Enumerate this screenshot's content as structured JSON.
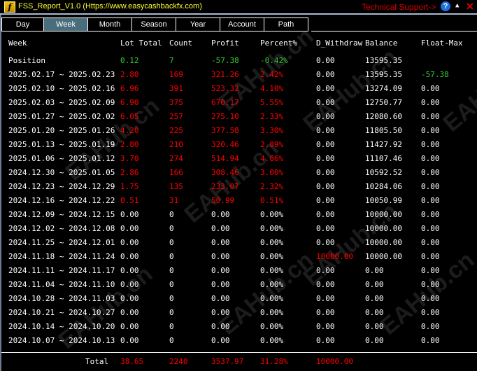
{
  "window": {
    "title": "FSS_Report_V1.0 (Https://www.easycashbackfx.com)",
    "logo_letter": "f",
    "support": "Technical Support->",
    "help": "?",
    "minimize": "▲",
    "close": "✕"
  },
  "tabs": [
    {
      "label": "Day"
    },
    {
      "label": "Week",
      "active": true
    },
    {
      "label": "Month"
    },
    {
      "label": "Season"
    },
    {
      "label": "Year"
    },
    {
      "label": "Account"
    },
    {
      "label": "Path"
    }
  ],
  "colors": {
    "w": "#ffffff",
    "r": "#ff0000",
    "g": "#33cc33"
  },
  "columns": [
    "Week",
    "Lot Total",
    "Count",
    "Profit",
    "Percent%",
    "D_Withdraw",
    "Balance",
    "Float-Max"
  ],
  "rows": [
    [
      [
        "Position",
        "w"
      ],
      [
        "0.12",
        "g"
      ],
      [
        "7",
        "g"
      ],
      [
        "-57.38",
        "g"
      ],
      [
        "-0.42%",
        "g"
      ],
      [
        "0.00",
        "w"
      ],
      [
        "13595.35",
        "w"
      ],
      [
        "",
        "w"
      ]
    ],
    [
      [
        "2025.02.17 ~ 2025.02.23",
        "w"
      ],
      [
        "2.80",
        "r"
      ],
      [
        "169",
        "r"
      ],
      [
        "321.26",
        "r"
      ],
      [
        "2.42%",
        "r"
      ],
      [
        "0.00",
        "w"
      ],
      [
        "13595.35",
        "w"
      ],
      [
        "-57.38",
        "g"
      ]
    ],
    [
      [
        "2025.02.10 ~ 2025.02.16",
        "w"
      ],
      [
        "6.96",
        "r"
      ],
      [
        "391",
        "r"
      ],
      [
        "523.32",
        "r"
      ],
      [
        "4.10%",
        "r"
      ],
      [
        "0.00",
        "w"
      ],
      [
        "13274.09",
        "w"
      ],
      [
        "0.00",
        "w"
      ]
    ],
    [
      [
        "2025.02.03 ~ 2025.02.09",
        "w"
      ],
      [
        "6.90",
        "r"
      ],
      [
        "375",
        "r"
      ],
      [
        "670.17",
        "r"
      ],
      [
        "5.55%",
        "r"
      ],
      [
        "0.00",
        "w"
      ],
      [
        "12750.77",
        "w"
      ],
      [
        "0.00",
        "w"
      ]
    ],
    [
      [
        "2025.01.27 ~ 2025.02.02",
        "w"
      ],
      [
        "6.05",
        "r"
      ],
      [
        "257",
        "r"
      ],
      [
        "275.10",
        "r"
      ],
      [
        "2.33%",
        "r"
      ],
      [
        "0.00",
        "w"
      ],
      [
        "12080.60",
        "w"
      ],
      [
        "0.00",
        "w"
      ]
    ],
    [
      [
        "2025.01.20 ~ 2025.01.26",
        "w"
      ],
      [
        "4.20",
        "r"
      ],
      [
        "225",
        "r"
      ],
      [
        "377.58",
        "r"
      ],
      [
        "3.30%",
        "r"
      ],
      [
        "0.00",
        "w"
      ],
      [
        "11805.50",
        "w"
      ],
      [
        "0.00",
        "w"
      ]
    ],
    [
      [
        "2025.01.13 ~ 2025.01.19",
        "w"
      ],
      [
        "2.80",
        "r"
      ],
      [
        "210",
        "r"
      ],
      [
        "320.46",
        "r"
      ],
      [
        "2.89%",
        "r"
      ],
      [
        "0.00",
        "w"
      ],
      [
        "11427.92",
        "w"
      ],
      [
        "0.00",
        "w"
      ]
    ],
    [
      [
        "2025.01.06 ~ 2025.01.12",
        "w"
      ],
      [
        "3.70",
        "r"
      ],
      [
        "274",
        "r"
      ],
      [
        "514.94",
        "r"
      ],
      [
        "4.86%",
        "r"
      ],
      [
        "0.00",
        "w"
      ],
      [
        "11107.46",
        "w"
      ],
      [
        "0.00",
        "w"
      ]
    ],
    [
      [
        "2024.12.30 ~ 2025.01.05",
        "w"
      ],
      [
        "2.86",
        "r"
      ],
      [
        "166",
        "r"
      ],
      [
        "308.46",
        "r"
      ],
      [
        "3.00%",
        "r"
      ],
      [
        "0.00",
        "w"
      ],
      [
        "10592.52",
        "w"
      ],
      [
        "0.00",
        "w"
      ]
    ],
    [
      [
        "2024.12.23 ~ 2024.12.29",
        "w"
      ],
      [
        "1.75",
        "r"
      ],
      [
        "135",
        "r"
      ],
      [
        "233.07",
        "r"
      ],
      [
        "2.32%",
        "r"
      ],
      [
        "0.00",
        "w"
      ],
      [
        "10284.06",
        "w"
      ],
      [
        "0.00",
        "w"
      ]
    ],
    [
      [
        "2024.12.16 ~ 2024.12.22",
        "w"
      ],
      [
        "0.51",
        "r"
      ],
      [
        "31",
        "r"
      ],
      [
        "50.99",
        "r"
      ],
      [
        "0.51%",
        "r"
      ],
      [
        "0.00",
        "w"
      ],
      [
        "10050.99",
        "w"
      ],
      [
        "0.00",
        "w"
      ]
    ],
    [
      [
        "2024.12.09 ~ 2024.12.15",
        "w"
      ],
      [
        "0.00",
        "w"
      ],
      [
        "0",
        "w"
      ],
      [
        "0.00",
        "w"
      ],
      [
        "0.00%",
        "w"
      ],
      [
        "0.00",
        "w"
      ],
      [
        "10000.00",
        "w"
      ],
      [
        "0.00",
        "w"
      ]
    ],
    [
      [
        "2024.12.02 ~ 2024.12.08",
        "w"
      ],
      [
        "0.00",
        "w"
      ],
      [
        "0",
        "w"
      ],
      [
        "0.00",
        "w"
      ],
      [
        "0.00%",
        "w"
      ],
      [
        "0.00",
        "w"
      ],
      [
        "10000.00",
        "w"
      ],
      [
        "0.00",
        "w"
      ]
    ],
    [
      [
        "2024.11.25 ~ 2024.12.01",
        "w"
      ],
      [
        "0.00",
        "w"
      ],
      [
        "0",
        "w"
      ],
      [
        "0.00",
        "w"
      ],
      [
        "0.00%",
        "w"
      ],
      [
        "0.00",
        "w"
      ],
      [
        "10000.00",
        "w"
      ],
      [
        "0.00",
        "w"
      ]
    ],
    [
      [
        "2024.11.18 ~ 2024.11.24",
        "w"
      ],
      [
        "0.00",
        "w"
      ],
      [
        "0",
        "w"
      ],
      [
        "0.00",
        "w"
      ],
      [
        "0.00%",
        "w"
      ],
      [
        "10000.00",
        "r"
      ],
      [
        "10000.00",
        "w"
      ],
      [
        "0.00",
        "w"
      ]
    ],
    [
      [
        "2024.11.11 ~ 2024.11.17",
        "w"
      ],
      [
        "0.00",
        "w"
      ],
      [
        "0",
        "w"
      ],
      [
        "0.00",
        "w"
      ],
      [
        "0.00%",
        "w"
      ],
      [
        "0.00",
        "w"
      ],
      [
        "0.00",
        "w"
      ],
      [
        "0.00",
        "w"
      ]
    ],
    [
      [
        "2024.11.04 ~ 2024.11.10",
        "w"
      ],
      [
        "0.00",
        "w"
      ],
      [
        "0",
        "w"
      ],
      [
        "0.00",
        "w"
      ],
      [
        "0.00%",
        "w"
      ],
      [
        "0.00",
        "w"
      ],
      [
        "0.00",
        "w"
      ],
      [
        "0.00",
        "w"
      ]
    ],
    [
      [
        "2024.10.28 ~ 2024.11.03",
        "w"
      ],
      [
        "0.00",
        "w"
      ],
      [
        "0",
        "w"
      ],
      [
        "0.00",
        "w"
      ],
      [
        "0.00%",
        "w"
      ],
      [
        "0.00",
        "w"
      ],
      [
        "0.00",
        "w"
      ],
      [
        "0.00",
        "w"
      ]
    ],
    [
      [
        "2024.10.21 ~ 2024.10.27",
        "w"
      ],
      [
        "0.00",
        "w"
      ],
      [
        "0",
        "w"
      ],
      [
        "0.00",
        "w"
      ],
      [
        "0.00%",
        "w"
      ],
      [
        "0.00",
        "w"
      ],
      [
        "0.00",
        "w"
      ],
      [
        "0.00",
        "w"
      ]
    ],
    [
      [
        "2024.10.14 ~ 2024.10.20",
        "w"
      ],
      [
        "0.00",
        "w"
      ],
      [
        "0",
        "w"
      ],
      [
        "0.00",
        "w"
      ],
      [
        "0.00%",
        "w"
      ],
      [
        "0.00",
        "w"
      ],
      [
        "0.00",
        "w"
      ],
      [
        "0.00",
        "w"
      ]
    ],
    [
      [
        "2024.10.07 ~ 2024.10.13",
        "w"
      ],
      [
        "0.00",
        "w"
      ],
      [
        "0",
        "w"
      ],
      [
        "0.00",
        "w"
      ],
      [
        "0.00%",
        "w"
      ],
      [
        "0.00",
        "w"
      ],
      [
        "0.00",
        "w"
      ],
      [
        "0.00",
        "w"
      ]
    ]
  ],
  "total": [
    [
      "Total",
      "w"
    ],
    [
      "38.65",
      "r"
    ],
    [
      "2240",
      "r"
    ],
    [
      "3537.97",
      "r"
    ],
    [
      "31.28%",
      "r"
    ],
    [
      "10000.00",
      "r"
    ],
    [
      "",
      "w"
    ],
    [
      "",
      "w"
    ]
  ],
  "watermark": "EAHub.cn"
}
